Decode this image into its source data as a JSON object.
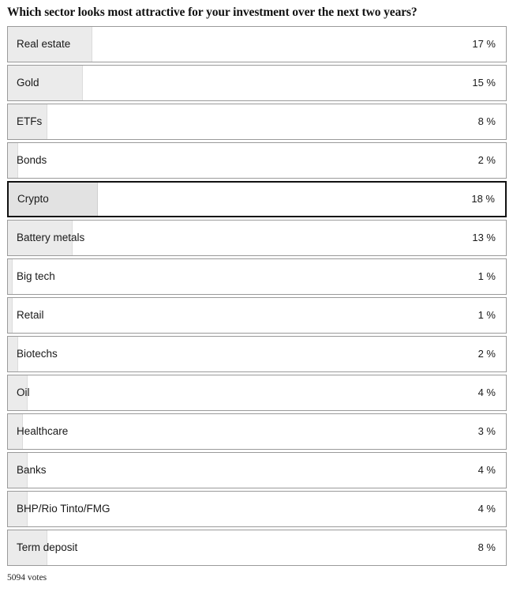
{
  "poll": {
    "question": "Which sector looks most attractive for your investment over the next two years?",
    "votes_text": "5094 votes",
    "selected_option": "Crypto",
    "colors": {
      "bar_fill": "#ebebeb",
      "bar_fill_selected": "#e2e2e2",
      "row_border": "#9a9a9a",
      "row_border_selected": "#111111",
      "text": "#1a1a1a",
      "background": "#ffffff"
    }
  },
  "chart_data": {
    "type": "bar",
    "title": "Which sector looks most attractive for your investment over the next two years?",
    "xlabel": "",
    "ylabel": "",
    "xlim": [
      0,
      100
    ],
    "grid": false,
    "legend": null,
    "orientation": "horizontal",
    "unit": "%",
    "total_votes": 5094,
    "categories": [
      "Real estate",
      "Gold",
      "ETFs",
      "Bonds",
      "Crypto",
      "Battery metals",
      "Big tech",
      "Retail",
      "Biotechs",
      "Oil",
      "Healthcare",
      "Banks",
      "BHP/Rio Tinto/FMG",
      "Term deposit"
    ],
    "values": [
      17,
      15,
      8,
      2,
      18,
      13,
      1,
      1,
      2,
      4,
      3,
      4,
      4,
      8
    ],
    "value_labels": [
      "17 %",
      "15 %",
      "8 %",
      "2 %",
      "18 %",
      "13 %",
      "1 %",
      "1 %",
      "2 %",
      "4 %",
      "3 %",
      "4 %",
      "4 %",
      "8 %"
    ],
    "highlighted_index": 4
  }
}
